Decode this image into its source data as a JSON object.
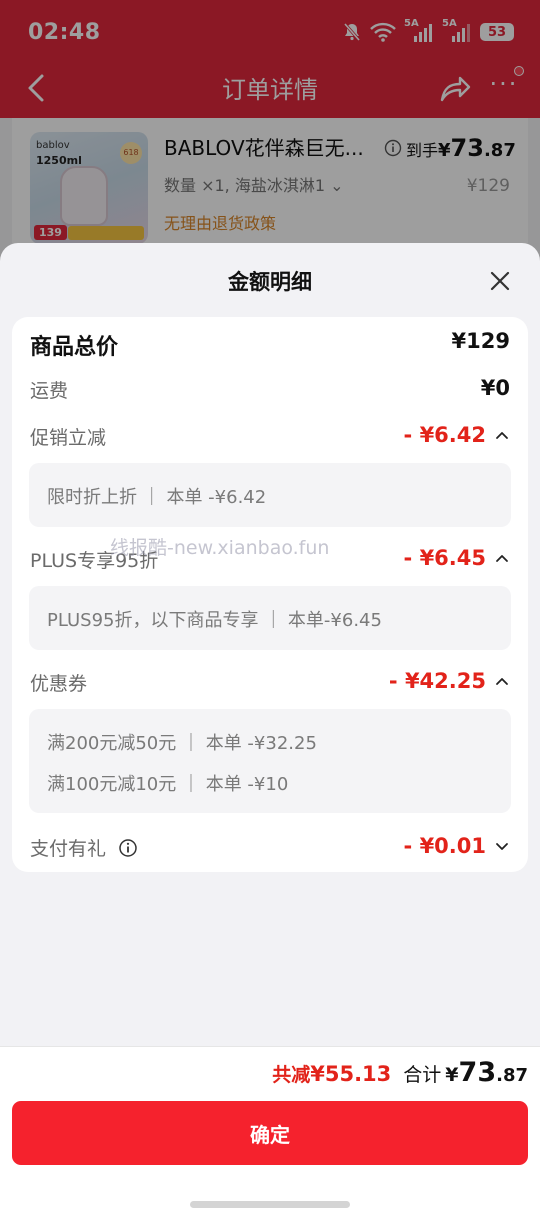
{
  "status_bar": {
    "time": "02:48",
    "network_1": "5A",
    "network_2": "5A",
    "battery": "53"
  },
  "nav": {
    "title": "订单详情"
  },
  "product": {
    "brand": "bablov",
    "volume": "1250ml",
    "badge": "618",
    "image_price": "139",
    "title": "BABLOV花伴森巨无...",
    "arrival_label": "到手",
    "arrival_currency": "¥",
    "arrival_int": "73",
    "arrival_dec": ".87",
    "spec": "数量 ×1, 海盐冰淇淋1 ⌄",
    "original_price": "¥129",
    "policy": "无理由退货政策"
  },
  "sheet": {
    "title": "金额明细",
    "rows": {
      "total_label": "商品总价",
      "total_value": "¥129",
      "shipping_label": "运费",
      "shipping_value": "¥0",
      "promo_label": "促销立减",
      "promo_value": "- ¥6.42",
      "promo_detail": "限时折上折  ｜  本单 -¥6.42",
      "plus_label": "PLUS专享95折",
      "plus_value": "- ¥6.45",
      "plus_detail": "PLUS95折，以下商品专享  ｜  本单-¥6.45",
      "coupon_label": "优惠券",
      "coupon_value": "- ¥42.25",
      "coupon_detail_1": "满200元减50元  ｜  本单 -¥32.25",
      "coupon_detail_2": "满100元减10元  ｜  本单 -¥10",
      "gift_label": "支付有礼",
      "gift_value": "- ¥0.01"
    },
    "watermark": "线报酷-new.xianbao.fun"
  },
  "footer": {
    "discount_label": "共减",
    "discount_value": "¥55.13",
    "total_label": "合计",
    "total_currency": "¥",
    "total_int": "73",
    "total_dec": ".87",
    "confirm_label": "确定"
  },
  "colors": {
    "header_red": "#e0283c",
    "accent_red": "#e2231a",
    "button_red": "#f5222d",
    "policy_orange": "#d8862a"
  }
}
